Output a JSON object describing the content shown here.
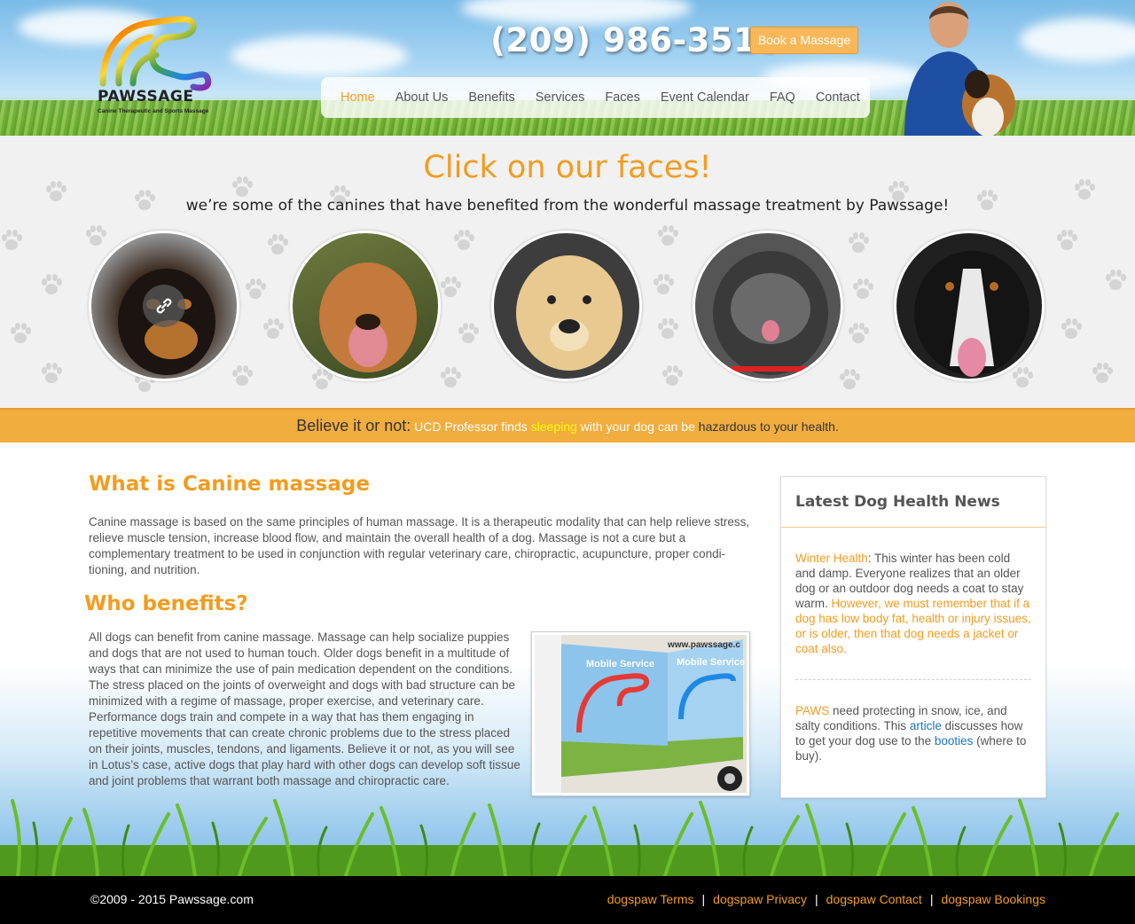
{
  "header": {
    "logo_word": "PAWSSAGE",
    "logo_tagline": "Canine Therapeutic and Sports Massage",
    "phone": "(209) 986-3516",
    "book_label": "Book a Massage"
  },
  "nav": {
    "items": [
      {
        "label": "Home",
        "active": true
      },
      {
        "label": "About Us"
      },
      {
        "label": "Benefits"
      },
      {
        "label": "Services"
      },
      {
        "label": "Faces"
      },
      {
        "label": "Event Calendar"
      },
      {
        "label": "FAQ"
      },
      {
        "label": "Contact"
      }
    ]
  },
  "faces": {
    "title": "Click on our faces!",
    "subtitle": "we’re some of the canines that have benefited from the wonderful massage treatment by Pawssage!",
    "link_icon": "link-icon"
  },
  "banner": {
    "lead": "Believe it or not:",
    "part1": " UCD Professor finds ",
    "highlight": "sleeping",
    "part2": " with your dog can be ",
    "dark": "hazardous",
    "part3": " to your health."
  },
  "main": {
    "what_title": "What is Canine massage",
    "what_text": "Canine massage is based on the same principles of human massage. It is a therapeutic modality that can help relieve stress, relieve muscle tension, increase blood flow, and maintain the overall health of a dog. Massage is not a cure but a complementary treatment to be used in conjunction with regular veterinary care, chiropractic, acupuncture, proper condi-tioning, and nutrition.",
    "who_title": "Who benefits?",
    "who_text": "All dogs can benefit from canine massage. Massage can help socialize puppies and dogs that are not used to human touch. Older dogs benefit in a multitude of ways that can minimize the use of pain medication dependent on the conditions. The stress placed on the joints of overweight and dogs with bad structure can be minimized with a regime of massage, proper exercise, and veterinary care. Performance dogs train and compete in a way that has them engaging in repetitive movements that can create chronic problems due to the stress placed on their joints, muscles, tendons, and ligaments. Believe it or not, as you will see in Lotus’s case, active dogs that play hard with other dogs can develop soft tissue and joint problems that warrant both massage and chiropractic care.",
    "trailer_text_1": "Mobile Service",
    "trailer_text_2": "www.pawssage.c"
  },
  "sidebar": {
    "title": "Latest Dog Health News",
    "news1_link": "Winter Health",
    "news1_text": ": This winter has been cold and damp. Everyone realizes that an older dog or an outdoor dog needs a coat to stay warm. ",
    "news1_highlight": "However, we must remember that if a dog has low body fat, health or injury issues, or is older, then that dog needs a jacket or coat also.",
    "news2_lead": "PAWS",
    "news2_text1": " need protecting in snow, ice, and salty conditions. This ",
    "news2_link1": "article",
    "news2_text2": " discusses how to get your dog use to the ",
    "news2_link2": "booties",
    "news2_text3": " (where to buy)."
  },
  "footer": {
    "copyright": "©2009 - 2015 Pawssage.com",
    "links": [
      "dogspaw Terms",
      "dogspaw Privacy",
      "dogspaw Contact",
      "dogspaw Bookings"
    ],
    "separator": "|"
  },
  "colors": {
    "accent": "#f39c1f",
    "banner": "#f2ad3f",
    "link_blue": "#1a73c6"
  }
}
